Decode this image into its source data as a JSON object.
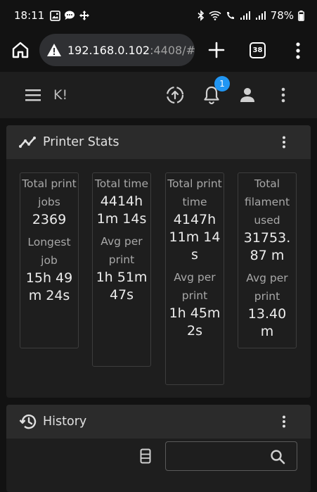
{
  "status_bar": {
    "time": "18:11",
    "battery": "78%"
  },
  "browser": {
    "url_host": "192.168.0.102",
    "url_rest": ":4408/#",
    "tab_count": "38"
  },
  "app": {
    "title": "K!",
    "notification_count": "1"
  },
  "printer_stats": {
    "title": "Printer Stats",
    "boxes": [
      {
        "label1": "Total print jobs",
        "value1": "2369",
        "label2": "Longest job",
        "value2": "15h 49m 24s"
      },
      {
        "label1": "Total time",
        "value1": "4414h 1m 14s",
        "label2": "Avg per print",
        "value2": "1h 51m 47s"
      },
      {
        "label1": "Total print time",
        "value1": "4147h 11m 14s",
        "label2": "Avg per print",
        "value2": "1h 45m 2s"
      },
      {
        "label1": "Total filament used",
        "value1": "31753.87 m",
        "label2": "Avg per print",
        "value2": "13.40 m"
      }
    ]
  },
  "history": {
    "title": "History",
    "search_value": ""
  },
  "colors": {
    "accent": "#2196f3",
    "card_bg": "#1e1e1e",
    "card_header_bg": "#2b2b2b",
    "page_bg": "#121212"
  }
}
